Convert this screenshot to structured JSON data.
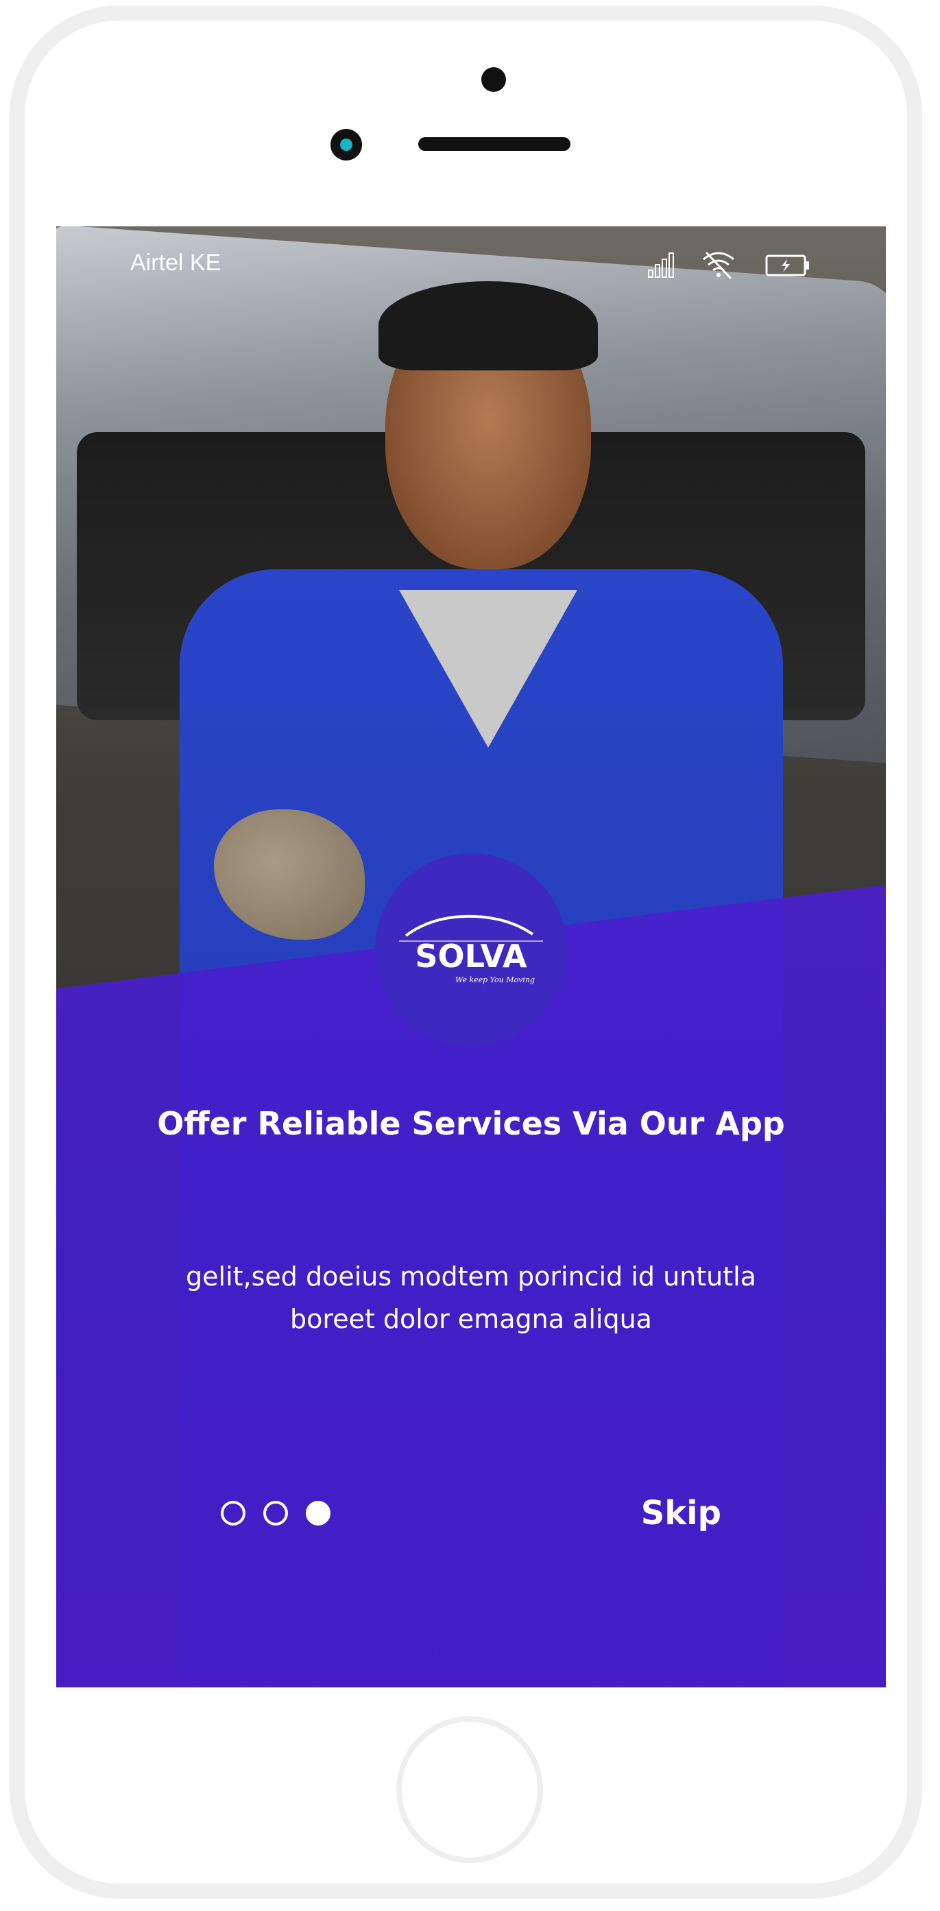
{
  "status_bar": {
    "carrier": "Airtel KE",
    "icons": [
      "signal-icon",
      "wifi-icon",
      "battery-icon"
    ]
  },
  "logo": {
    "text": "SOLVA",
    "tagline": "We keep You Moving"
  },
  "onboarding": {
    "title": "Offer Reliable Services Via Our App",
    "description": "gelit,sed doeius modtem porincid id untutla boreet dolor emagna aliqua",
    "page_count": 3,
    "active_page": 3,
    "skip_label": "Skip"
  },
  "colors": {
    "overlay": "#4a1fcd",
    "logo_badge": "#3d28c0",
    "text": "#ffffff",
    "phone_frame": "#efefef",
    "camera_lens": "#1ab3c4"
  }
}
